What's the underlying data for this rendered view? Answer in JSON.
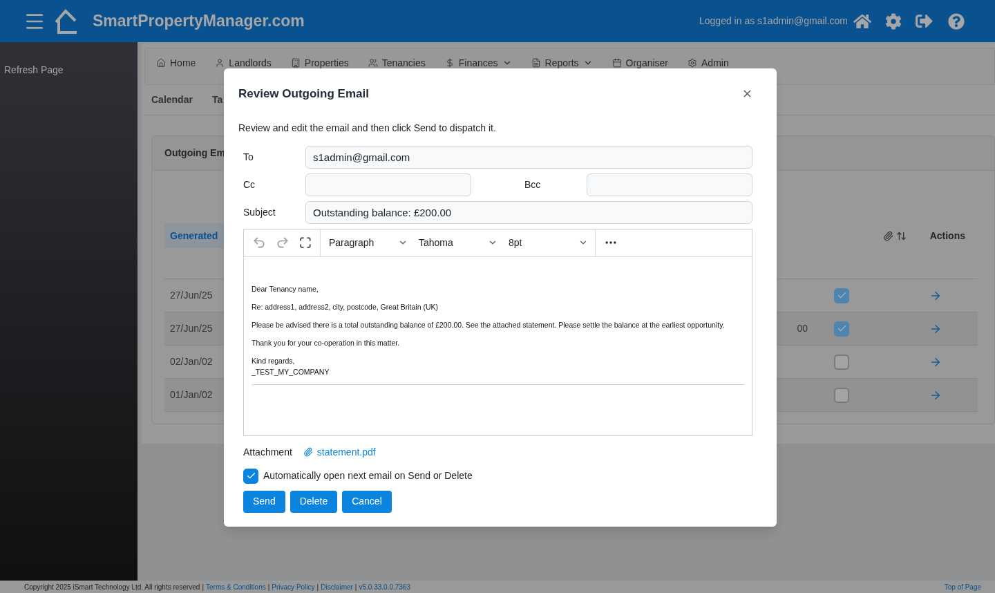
{
  "header": {
    "title": "SmartPropertyManager.com",
    "logged_in": "Logged in as s1admin@gmail.com"
  },
  "sidebar": {
    "items": [
      {
        "label": "Refresh Page"
      }
    ]
  },
  "nav": [
    {
      "label": "Home",
      "dropdown": false
    },
    {
      "label": "Landlords",
      "dropdown": false
    },
    {
      "label": "Properties",
      "dropdown": false
    },
    {
      "label": "Tenancies",
      "dropdown": false
    },
    {
      "label": "Finances",
      "dropdown": true
    },
    {
      "label": "Reports",
      "dropdown": true
    },
    {
      "label": "Organiser",
      "dropdown": false
    },
    {
      "label": "Admin",
      "dropdown": false
    }
  ],
  "subtabs": [
    {
      "label": "Calendar"
    },
    {
      "label": "Ta"
    }
  ],
  "card": {
    "title": "Outgoing Em",
    "columns": [
      {
        "label": "Generated"
      },
      {
        "label": "Actions"
      }
    ],
    "rows": [
      {
        "generated": "27/Jun/25",
        "attachment": true
      },
      {
        "generated": "27/Jun/25",
        "column_2": "00",
        "attachment": true
      },
      {
        "generated": "02/Jan/02",
        "attachment": false
      },
      {
        "generated": "01/Jan/02",
        "attachment": false
      }
    ]
  },
  "modal": {
    "title": "Review Outgoing Email",
    "intro": "Review and edit the email and then click Send to dispatch it.",
    "fields": {
      "to": {
        "label": "To",
        "value": "s1admin@gmail.com"
      },
      "cc": {
        "label": "Cc"
      },
      "bcc": {
        "label": "Bcc"
      },
      "subject": {
        "label": "Subject",
        "value": "Outstanding balance: £200.00"
      }
    },
    "toolbar": {
      "block": "Paragraph",
      "font": "Tahoma",
      "size": "8pt"
    },
    "body": [
      [
        "Dear Tenancy name,"
      ],
      [
        "Re: address1, address2, city, postcode, Great Britain (UK)"
      ],
      [
        "Please be advised there is a total outstanding balance of £200.00. See the attached statement. Please settle the balance at the earliest opportunity."
      ],
      [
        "Thank you for your co-operation in this matter."
      ],
      [
        "Kind regards,",
        "_TEST_MY_COMPANY"
      ]
    ],
    "attachment": {
      "label": "Attachment",
      "file": "statement.pdf"
    },
    "auto_open": {
      "label": "Automatically open next email on Send or Delete",
      "checked": true
    },
    "buttons": [
      "Send",
      "Delete",
      "Cancel"
    ]
  },
  "footer": {
    "copyright": "Copyright 2025 iSmart Technology Ltd. All rights reserved",
    "separator": "|",
    "links": [
      "Terms & Conditions",
      "Privacy Policy",
      "Disclaimer",
      "v5.0.33.0.0.7363"
    ],
    "top": "Top of Page"
  }
}
